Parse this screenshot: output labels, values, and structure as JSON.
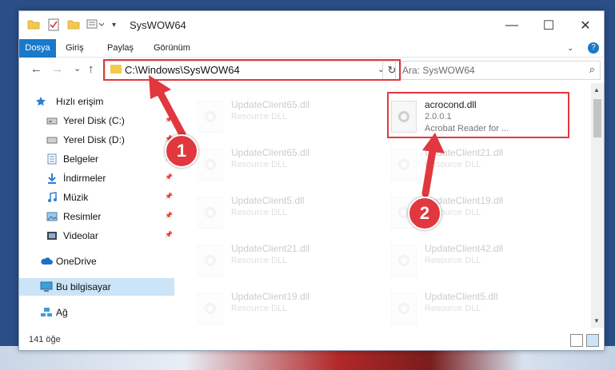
{
  "window": {
    "title": "SysWOW64",
    "controls": {
      "minimize": "—",
      "maximize": "☐",
      "close": "✕"
    }
  },
  "ribbon": {
    "tabs": [
      "Dosya",
      "Giriş",
      "Paylaş",
      "Görünüm"
    ],
    "help": "?"
  },
  "nav": {
    "back": "←",
    "forward": "→",
    "recent": "⌄",
    "up": "↑",
    "address": "C:\\Windows\\SysWOW64",
    "address_dropdown": "⌄",
    "refresh": "↻",
    "search_placeholder": "Ara: SysWOW64",
    "search_icon": "⌕"
  },
  "sidebar": {
    "items": [
      {
        "label": "Hızlı erişim",
        "icon": "star-icon",
        "pinned": false
      },
      {
        "label": "Yerel Disk (C:)",
        "icon": "drive-icon",
        "pinned": true
      },
      {
        "label": "Yerel Disk (D:)",
        "icon": "drive-icon",
        "pinned": true
      },
      {
        "label": "Belgeler",
        "icon": "documents-icon",
        "pinned": true
      },
      {
        "label": "İndirmeler",
        "icon": "download-icon",
        "pinned": true
      },
      {
        "label": "Müzik",
        "icon": "music-icon",
        "pinned": true
      },
      {
        "label": "Resimler",
        "icon": "pictures-icon",
        "pinned": true
      },
      {
        "label": "Videolar",
        "icon": "videos-icon",
        "pinned": true
      },
      {
        "label": "OneDrive",
        "icon": "cloud-icon",
        "pinned": false
      },
      {
        "label": "Bu bilgisayar",
        "icon": "computer-icon",
        "pinned": false,
        "selected": true
      },
      {
        "label": "Ağ",
        "icon": "network-icon",
        "pinned": false
      }
    ],
    "pin_glyph": "📌"
  },
  "files": [
    {
      "name": "UpdateClient65.dll",
      "type": "Resource DLL",
      "faded": true
    },
    {
      "name": "acrocond.dll",
      "version": "2.0.0.1",
      "description": "Acrobat Reader for ...",
      "faded": false
    },
    {
      "name": "UpdateClient65.dll",
      "type": "Resource DLL",
      "faded": true
    },
    {
      "name": "UpdateClient21.dll",
      "type": "Resource DLL",
      "faded": true
    },
    {
      "name": "UpdateClient5.dll",
      "type": "Resource DLL",
      "faded": true
    },
    {
      "name": "UpdateClient19.dll",
      "type": "Resource DLL",
      "faded": true
    },
    {
      "name": "UpdateClient21.dll",
      "type": "Resource DLL",
      "faded": true
    },
    {
      "name": "UpdateClient42.dll",
      "type": "Resource DLL",
      "faded": true
    },
    {
      "name": "UpdateClient19.dll",
      "type": "Resource DLL",
      "faded": true
    },
    {
      "name": "UpdateClient5.dll",
      "type": "Resource DLL",
      "faded": true
    }
  ],
  "status": {
    "count": "141 öğe"
  },
  "annotations": {
    "step1": "1",
    "step2": "2",
    "color": "#e0383e"
  },
  "colors": {
    "file_tab": "#1979ca",
    "selection": "#cce4f7",
    "folder": "#f2c94c"
  }
}
